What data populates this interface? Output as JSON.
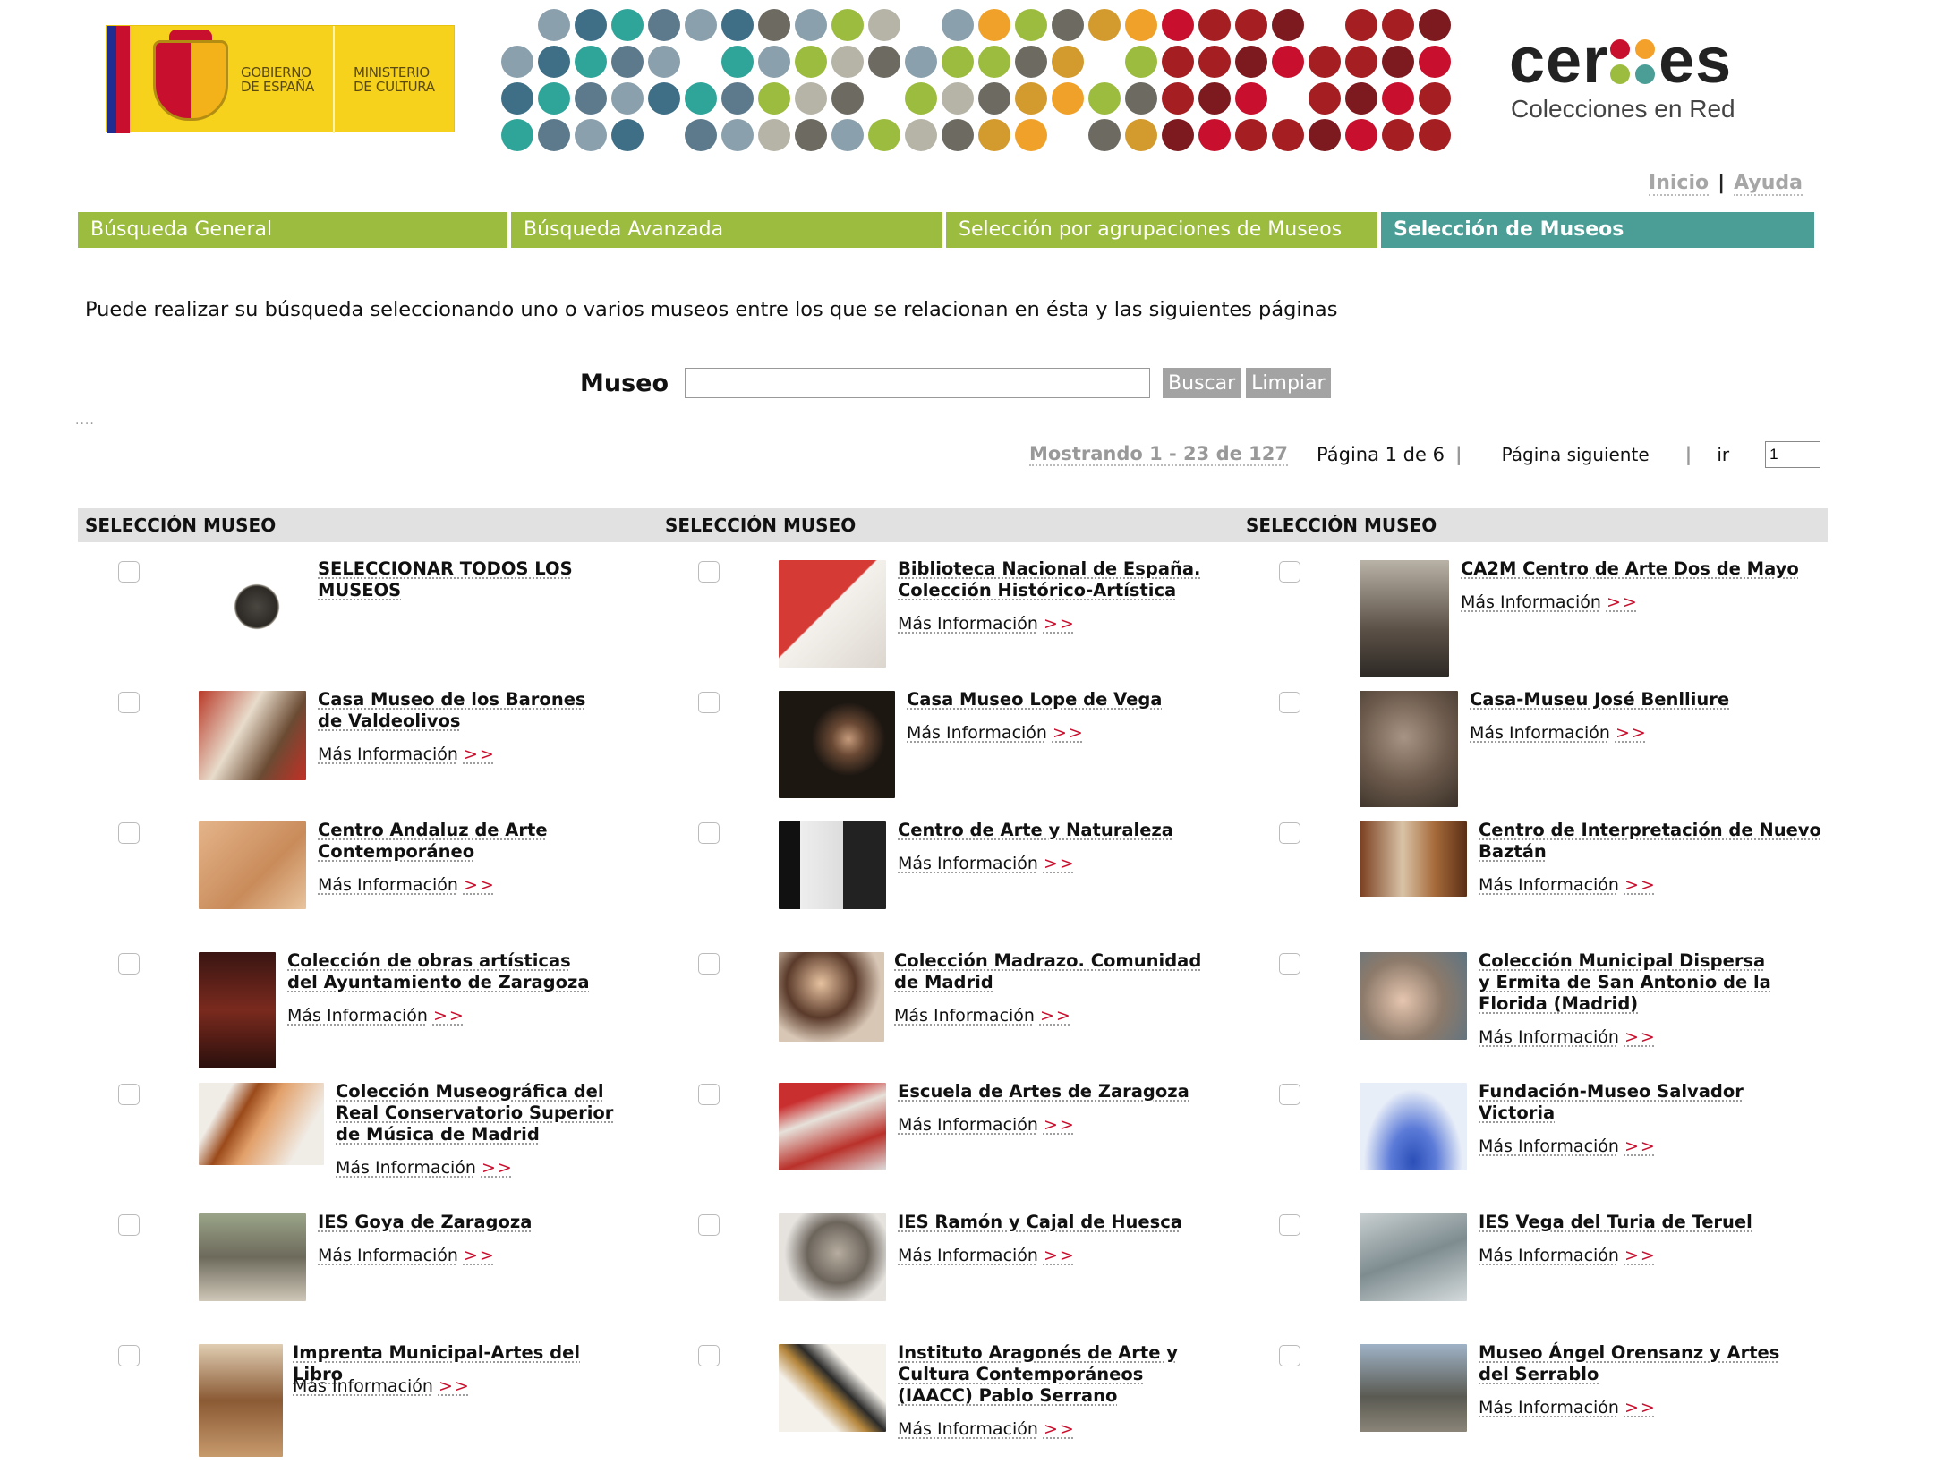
{
  "header": {
    "gov_text_1": "GOBIERNO\nDE ESPAÑA",
    "gov_text_2": "MINISTERIO\nDE CULTURA",
    "brand_pre": "cer",
    "brand_post": "es",
    "brand_sub": "Colecciones en Red",
    "links": {
      "home": "Inicio",
      "separator": "|",
      "help": "Ayuda"
    }
  },
  "tabs": [
    {
      "label": "Búsqueda General",
      "active": false
    },
    {
      "label": "Búsqueda Avanzada",
      "active": false
    },
    {
      "label": "Selección por agrupaciones de Museos",
      "active": false
    },
    {
      "label": "Selección de Museos",
      "active": true
    }
  ],
  "intro": "Puede realizar su búsqueda seleccionando uno o varios museos entre los que se relacionan en ésta y las siguientes páginas",
  "search": {
    "label": "Museo",
    "value": "",
    "search_button": "Buscar",
    "clear_button": "Limpiar"
  },
  "pager": {
    "showing": "Mostrando 1 - 23 de 127",
    "page_info": "Página 1 de 6",
    "bar": "|",
    "next": "Página siguiente",
    "go_label": "ir",
    "go_value": "1"
  },
  "table": {
    "col_select": "SELECCIÓN",
    "col_museum": "MUSEO",
    "more_label": "Más Información",
    "more_arrow": ">>",
    "rows": [
      [
        {
          "name": "SELECCIONAR TODOS LOS MUSEOS",
          "more": false
        },
        {
          "name": "Biblioteca Nacional de España. Colección Histórico-Artística",
          "more": true
        },
        {
          "name": "CA2M Centro de Arte Dos de Mayo",
          "more": true
        }
      ],
      [
        {
          "name": "Casa Museo de los Barones de Valdeolivos",
          "more": true
        },
        {
          "name": "Casa Museo Lope de Vega",
          "more": true
        },
        {
          "name": "Casa-Museu José Benlliure",
          "more": true
        }
      ],
      [
        {
          "name": "Centro Andaluz de Arte Contemporáneo",
          "more": true
        },
        {
          "name": "Centro de Arte y Naturaleza",
          "more": true
        },
        {
          "name": "Centro de Interpretación de Nuevo Baztán",
          "more": true
        }
      ],
      [
        {
          "name": "Colección de obras artísticas del Ayuntamiento de Zaragoza",
          "more": true
        },
        {
          "name": "Colección Madrazo. Comunidad de Madrid",
          "more": true
        },
        {
          "name": "Colección Municipal Dispersa y Ermita de San Antonio de la Florida (Madrid)",
          "more": true
        }
      ],
      [
        {
          "name": "Colección Museográfica del Real Conservatorio Superior de Música de Madrid",
          "more": true
        },
        {
          "name": "Escuela de Artes de Zaragoza",
          "more": true
        },
        {
          "name": "Fundación-Museo Salvador Victoria",
          "more": true
        }
      ],
      [
        {
          "name": "IES Goya de Zaragoza",
          "more": true
        },
        {
          "name": "IES Ramón y Cajal de Huesca",
          "more": true
        },
        {
          "name": "IES Vega del Turia de Teruel",
          "more": true
        }
      ],
      [
        {
          "name": "Imprenta Municipal-Artes del Libro",
          "more": true
        },
        {
          "name": "Instituto Aragonés de Arte y Cultura Contemporáneos (IAACC) Pablo Serrano",
          "more": true
        },
        {
          "name": "Museo Ángel Orensanz y Artes del Serrablo",
          "more": true
        }
      ]
    ]
  },
  "colors": {
    "tab_green": "#9cbc3f",
    "tab_teal": "#4a9e96",
    "link_arrow_red": "#c8102e",
    "header_row_gray": "#e1e1e1"
  }
}
